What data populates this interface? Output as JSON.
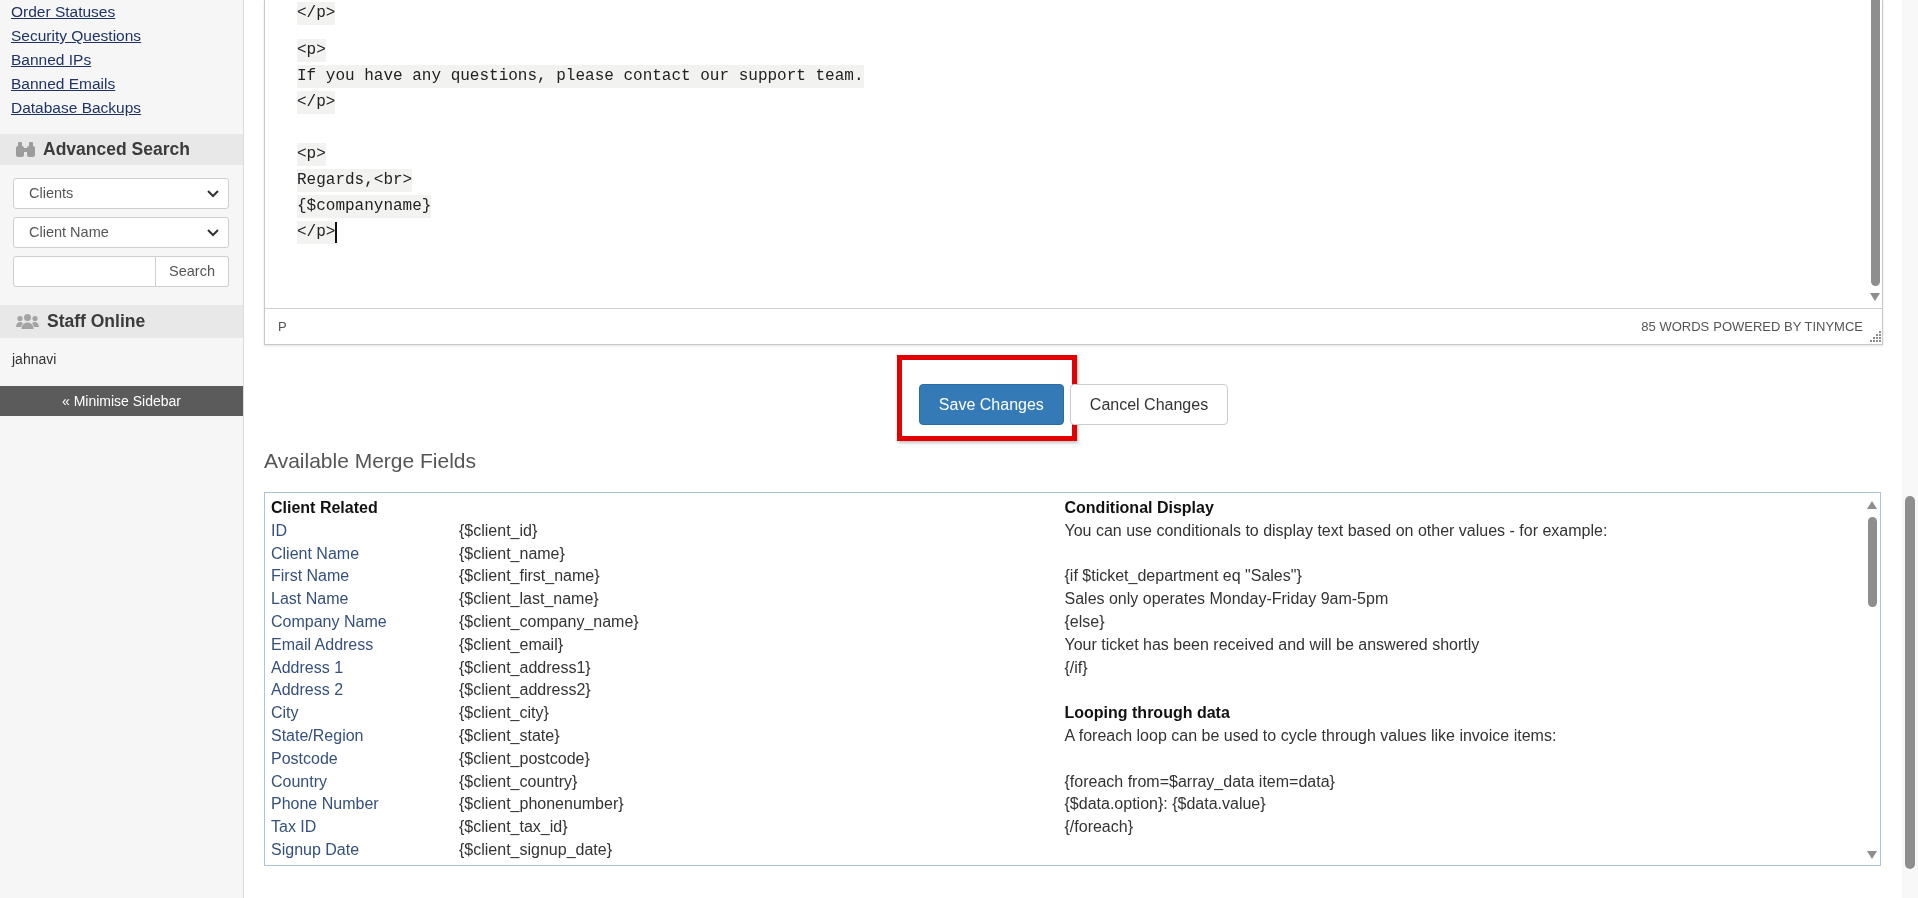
{
  "sidebar": {
    "links": [
      "Order Statuses",
      "Security Questions",
      "Banned IPs",
      "Banned Emails",
      "Database Backups"
    ],
    "advanced_search": {
      "title": "Advanced Search",
      "selects": [
        {
          "value": "Clients"
        },
        {
          "value": "Client Name"
        }
      ],
      "button": "Search"
    },
    "staff_online": {
      "title": "Staff Online",
      "staff": [
        "jahnavi"
      ]
    },
    "minimise_button": "« Minimise Sidebar"
  },
  "editor": {
    "blocks": [
      [
        "</p>"
      ],
      [
        "<p>",
        "If you have any questions, please contact our support team.",
        "</p>"
      ],
      [
        "<p>",
        "Regards,<br>",
        "{$companyname}",
        "</p>"
      ]
    ],
    "caret": true,
    "status_bar": {
      "path": "P",
      "word_count": "85 WORDS",
      "branding": "POWERED BY TINYMCE"
    }
  },
  "actions": [
    {
      "label": "Save Changes",
      "kind": "primary",
      "highlighted": true
    },
    {
      "label": "Cancel Changes",
      "kind": "default",
      "highlighted": false
    }
  ],
  "merge_fields": {
    "title": "Available Merge Fields",
    "client_related": {
      "title": "Client Related",
      "fields": [
        {
          "label": "ID",
          "tag": "{$client_id}"
        },
        {
          "label": "Client Name",
          "tag": "{$client_name}"
        },
        {
          "label": "First Name",
          "tag": "{$client_first_name}"
        },
        {
          "label": "Last Name",
          "tag": "{$client_last_name}"
        },
        {
          "label": "Company Name",
          "tag": "{$client_company_name}"
        },
        {
          "label": "Email Address",
          "tag": "{$client_email}"
        },
        {
          "label": "Address 1",
          "tag": "{$client_address1}"
        },
        {
          "label": "Address 2",
          "tag": "{$client_address2}"
        },
        {
          "label": "City",
          "tag": "{$client_city}"
        },
        {
          "label": "State/Region",
          "tag": "{$client_state}"
        },
        {
          "label": "Postcode",
          "tag": "{$client_postcode}"
        },
        {
          "label": "Country",
          "tag": "{$client_country}"
        },
        {
          "label": "Phone Number",
          "tag": "{$client_phonenumber}"
        },
        {
          "label": "Tax ID",
          "tag": "{$client_tax_id}"
        },
        {
          "label": "Signup Date",
          "tag": "{$client_signup_date}"
        }
      ]
    },
    "sections": [
      {
        "title": "Conditional Display",
        "paragraphs": [
          [
            "You can use conditionals to display text based on other values - for example:"
          ],
          [
            "{if $ticket_department eq \"Sales\"}",
            "Sales only operates Monday-Friday 9am-5pm",
            "{else}",
            "Your ticket has been received and will be answered shortly",
            "{/if}"
          ]
        ]
      },
      {
        "title": "Looping through data",
        "paragraphs": [
          [
            "A foreach loop can be used to cycle through values like invoice items:"
          ],
          [
            "{foreach from=$array_data item=data}",
            "{$data.option}: {$data.value}",
            "{/foreach}"
          ]
        ]
      }
    ]
  }
}
